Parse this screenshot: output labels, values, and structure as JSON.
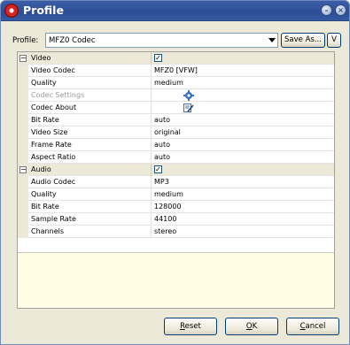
{
  "window": {
    "title": "Profile"
  },
  "profile": {
    "label": "Profile:",
    "value": "MFZ0 Codec",
    "save_as": "Save As...",
    "v": "V"
  },
  "grid": {
    "video_category": {
      "label": "Video",
      "checked": true
    },
    "video_rows": [
      {
        "name": "Video Codec",
        "value": "MFZ0 [VFW]"
      },
      {
        "name": "Quality",
        "value": "medium"
      },
      {
        "name": "Codec Settings",
        "value": "",
        "icon": "gear-icon",
        "disabled": true
      },
      {
        "name": "Codec About",
        "value": "",
        "icon": "edit-icon"
      },
      {
        "name": "Bit Rate",
        "value": "auto"
      },
      {
        "name": "Video Size",
        "value": "original"
      },
      {
        "name": "Frame Rate",
        "value": "auto"
      },
      {
        "name": "Aspect Ratio",
        "value": "auto"
      }
    ],
    "audio_category": {
      "label": "Audio",
      "checked": true
    },
    "audio_rows": [
      {
        "name": "Audio Codec",
        "value": "MP3"
      },
      {
        "name": "Quality",
        "value": "medium"
      },
      {
        "name": "Bit Rate",
        "value": "128000"
      },
      {
        "name": "Sample Rate",
        "value": "44100"
      },
      {
        "name": "Channels",
        "value": "stereo"
      }
    ]
  },
  "buttons": {
    "reset": {
      "mnemonic": "R",
      "rest": "eset"
    },
    "ok": {
      "mnemonic": "O",
      "rest": "K"
    },
    "cancel": {
      "mnemonic": "C",
      "rest": "ancel"
    }
  },
  "colors": {
    "titlebar": "#2d4e96",
    "info_area": "#fffee5",
    "category_row": "#ece9d8"
  }
}
